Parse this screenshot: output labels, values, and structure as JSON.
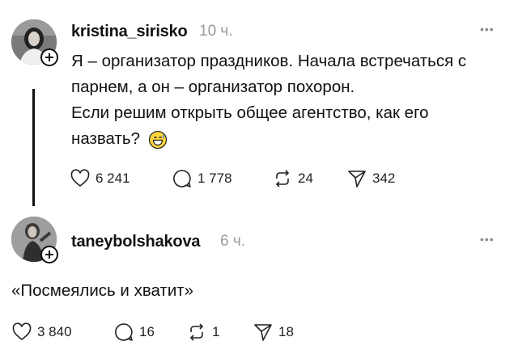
{
  "posts": [
    {
      "username": "kristina_sirisko",
      "time": "10 ч.",
      "more": "•••",
      "lines": [
        "Я – организатор праздников. Начала встречаться с",
        "парнем, а он – организатор похорон.",
        "Если решим открыть общее агентство, как его",
        "назвать?"
      ],
      "emoji": "grinning-sweat-emoji",
      "stats": {
        "likes": "6 241",
        "comments": "1 778",
        "reposts": "24",
        "shares": "342"
      }
    },
    {
      "username": "taneybolshakova",
      "time": "6 ч.",
      "more": "•••",
      "lines": [
        "«Посмеялись и хватит»"
      ],
      "stats": {
        "likes": "3 840",
        "comments": "16",
        "reposts": "1",
        "shares": "18"
      }
    }
  ],
  "icons": [
    "heart-icon",
    "comment-icon",
    "repost-icon",
    "share-icon",
    "plus-icon",
    "more-icon"
  ]
}
